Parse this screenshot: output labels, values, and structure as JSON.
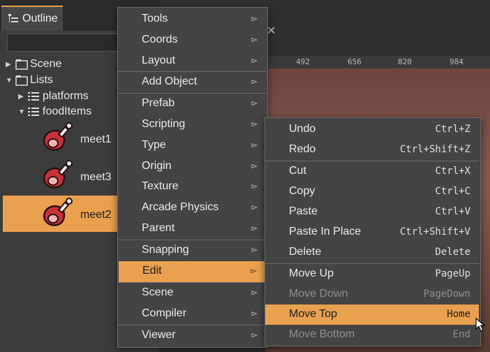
{
  "outline": {
    "tab_label": "Outline",
    "tree": [
      {
        "label": "Scene"
      },
      {
        "label": "Lists"
      },
      {
        "label": "platforms"
      },
      {
        "label": "foodItems"
      },
      {
        "label": "meet1"
      },
      {
        "label": "meet3"
      },
      {
        "label": "meet2"
      }
    ]
  },
  "ruler": [
    "492",
    "656",
    "820",
    "984"
  ],
  "main_menu": [
    {
      "label": "Tools"
    },
    {
      "label": "Coords"
    },
    {
      "label": "Layout"
    },
    {
      "label": "Add Object"
    },
    {
      "label": "Prefab"
    },
    {
      "label": "Scripting"
    },
    {
      "label": "Type"
    },
    {
      "label": "Origin"
    },
    {
      "label": "Texture"
    },
    {
      "label": "Arcade Physics"
    },
    {
      "label": "Parent"
    },
    {
      "label": "Snapping"
    },
    {
      "label": "Edit"
    },
    {
      "label": "Scene"
    },
    {
      "label": "Compiler"
    },
    {
      "label": "Viewer"
    }
  ],
  "arrow_glyph": "▻",
  "edit_menu": [
    {
      "label": "Undo",
      "key": "Ctrl+Z"
    },
    {
      "label": "Redo",
      "key": "Ctrl+Shift+Z"
    },
    {
      "label": "Cut",
      "key": "Ctrl+X"
    },
    {
      "label": "Copy",
      "key": "Ctrl+C"
    },
    {
      "label": "Paste",
      "key": "Ctrl+V"
    },
    {
      "label": "Paste In Place",
      "key": "Ctrl+Shift+V"
    },
    {
      "label": "Delete",
      "key": "Delete"
    },
    {
      "label": "Move Up",
      "key": "PageUp"
    },
    {
      "label": "Move Down",
      "key": "PageDown"
    },
    {
      "label": "Move Top",
      "key": "Home"
    },
    {
      "label": "Move Bottom",
      "key": "End"
    }
  ],
  "colors": {
    "accent": "#e9a04f",
    "menu_bg": "#444444"
  }
}
